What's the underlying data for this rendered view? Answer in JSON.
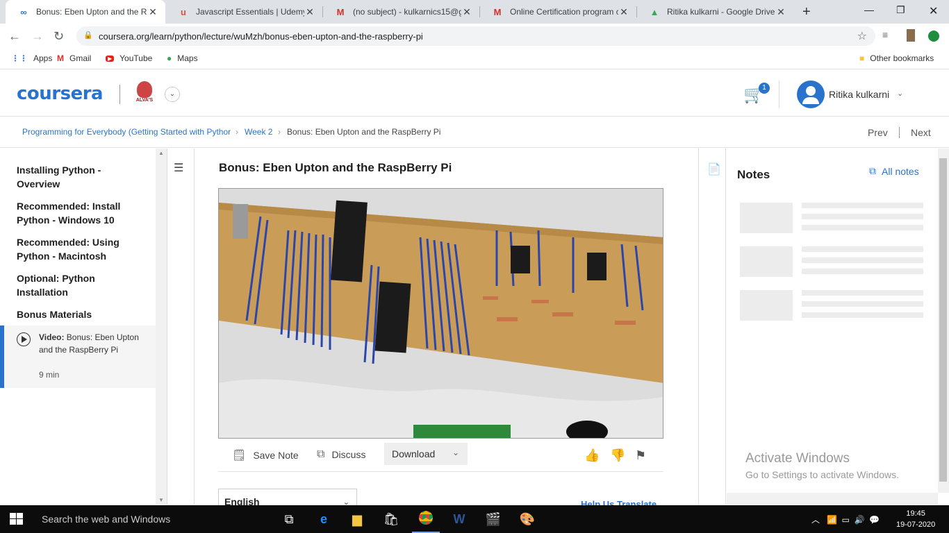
{
  "browser": {
    "tabs": [
      {
        "title": "Bonus: Eben Upton and the Ra",
        "icon": "coursera-icon",
        "color": "#2a73cc",
        "active": true
      },
      {
        "title": "Javascript Essentials | Udemy",
        "icon": "udemy-icon",
        "color": "#e0503f",
        "active": false
      },
      {
        "title": "(no subject) - kulkarnics15@g",
        "icon": "gmail-icon",
        "color": "#d93025",
        "active": false
      },
      {
        "title": "Online Certification program c",
        "icon": "gmail-icon",
        "color": "#d93025",
        "active": false
      },
      {
        "title": "Ritika kulkarni - Google Drive",
        "icon": "drive-icon",
        "color": "#34a853",
        "active": false
      }
    ],
    "url": "coursera.org/learn/python/lecture/wuMzh/bonus-eben-upton-and-the-raspberry-pi",
    "bookmarks": [
      {
        "label": "Apps",
        "icon": "apps-grid-icon"
      },
      {
        "label": "Gmail",
        "icon": "gmail-icon"
      },
      {
        "label": "YouTube",
        "icon": "youtube-icon"
      },
      {
        "label": "Maps",
        "icon": "maps-pin-icon"
      }
    ],
    "other_bookmarks": "Other bookmarks"
  },
  "header": {
    "logo": "coursera",
    "institution": "ALVA'S",
    "cart_count": "1",
    "user_name": "Ritika kulkarni"
  },
  "breadcrumb": {
    "course": "Programming for Everybody (Getting Started with Pythor",
    "week": "Week 2",
    "current": "Bonus: Eben Upton and the RaspBerry Pi",
    "prev": "Prev",
    "next": "Next"
  },
  "sidebar": {
    "items": [
      {
        "label": "Installing Python - Overview"
      },
      {
        "label": "Recommended: Install Python - Windows 10"
      },
      {
        "label": "Recommended: Using Python - Macintosh"
      },
      {
        "label": "Optional: Python Installation"
      },
      {
        "label": "Bonus Materials"
      }
    ],
    "active": {
      "kind": "Video:",
      "title": "Bonus: Eben Upton and the RaspBerry Pi",
      "duration": "9 min"
    }
  },
  "main": {
    "title": "Bonus: Eben Upton and the RaspBerry Pi",
    "save_note": "Save Note",
    "discuss": "Discuss",
    "download": "Download",
    "language": "English",
    "help_translate": "Help Us Translate"
  },
  "notes": {
    "title": "Notes",
    "all_notes": "All notes"
  },
  "watermark": {
    "line1": "Activate Windows",
    "line2": "Go to Settings to activate Windows."
  },
  "taskbar": {
    "search": "Search the web and Windows",
    "time": "19:45",
    "date": "19-07-2020"
  }
}
